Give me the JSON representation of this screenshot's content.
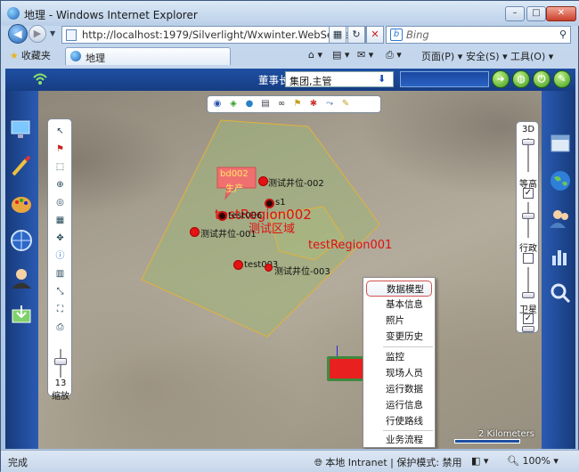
{
  "browser": {
    "title": "地理 - Windows Internet Explorer",
    "address": "http://localhost:1979/Silverlight/Wxwinter.WebServer.Si",
    "search_placeholder": "Bing",
    "favorites_label": "收藏夹",
    "tab_label": "地理",
    "commands": {
      "page": "页面(P)",
      "safety": "安全(S)",
      "tools": "工具(O)"
    },
    "status": "完成",
    "zone": "本地 Intranet | 保护模式: 禁用",
    "zoom": "100%"
  },
  "app": {
    "role_label": "董事长",
    "org_select": "集团,主管"
  },
  "map": {
    "tool_panel": {
      "zoom_value": "13",
      "zoom_label": "缩放"
    },
    "layers": [
      {
        "label": "3D"
      },
      {
        "label": "等高",
        "checked": true
      },
      {
        "label": "行政",
        "checked": false
      },
      {
        "label": "卫星",
        "checked": true
      }
    ],
    "region_texts": {
      "region1": "testRegion001",
      "region2": "testRegion002",
      "region_zone": "测试区域",
      "bubble": "bd002\n生产"
    },
    "points": [
      {
        "label": "测试井位-002"
      },
      {
        "label": "s1"
      },
      {
        "label": "test006"
      },
      {
        "label": "测试井位-001"
      },
      {
        "label": "test003"
      },
      {
        "label": "测试井位-003"
      }
    ],
    "context_menu": [
      "数据模型",
      "基本信息",
      "照片",
      "变更历史",
      "监控",
      "现场人员",
      "运行数据",
      "运行信息",
      "行使路线",
      "业务流程"
    ],
    "scale_label": "2 Kilometers"
  },
  "colors": {
    "app_blue": "#1f4fa3",
    "region_fill": "#9fb27a",
    "point_red": "#e31414",
    "map_text_red": "#e01010"
  }
}
